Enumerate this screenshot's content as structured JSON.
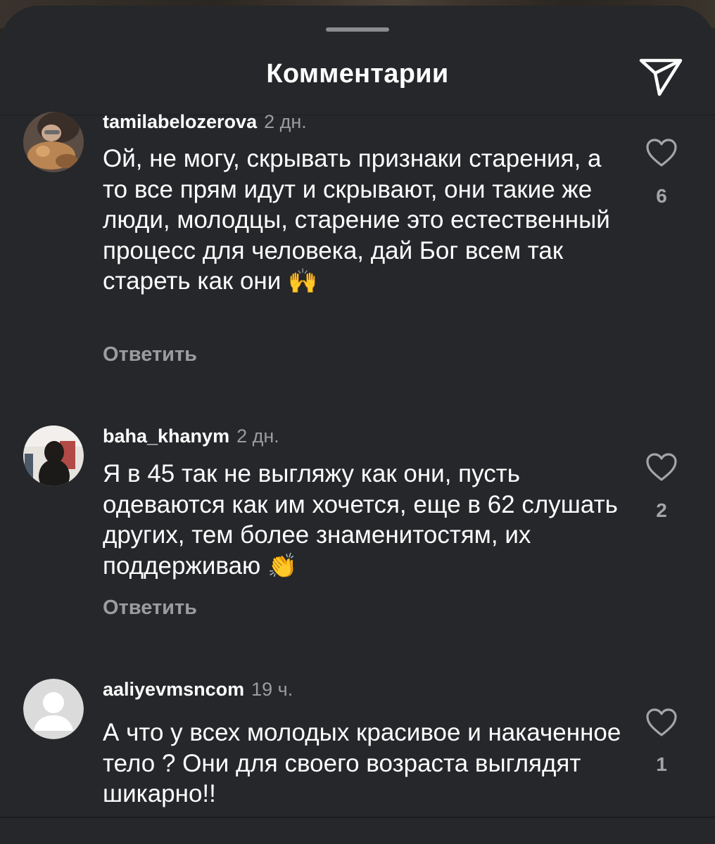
{
  "header": {
    "title": "Комментарии",
    "share_icon": "send-icon"
  },
  "comments": [
    {
      "username": "tamilabelozerova",
      "time": "2 дн.",
      "text": "Ой, не могу, скрывать признаки старения, а то все прям идут и скрывают, они такие же люди, молодцы, старение это естественный процесс для человека, дай Бог всем так стареть как они",
      "emoji": "🙌",
      "reply_label": "Ответить",
      "likes": "6",
      "avatar": "photo-avatar"
    },
    {
      "username": "baha_khanym",
      "time": "2 дн.",
      "text": "Я в 45 так не выгляжу как они, пусть одеваются как им хочется, еще в 62 слушать других, тем более знаменитостям, их поддерживаю",
      "emoji": "👏",
      "reply_label": "Ответить",
      "likes": "2",
      "avatar": "photo-avatar"
    },
    {
      "username": "aaliyevmsncom",
      "time": "19 ч.",
      "text": "А что у всех молодых красивое и накаченное тело ? Они для своего возраста выглядят шикарно!!",
      "likes": "1",
      "avatar": "default-avatar"
    }
  ],
  "colors": {
    "sheet_bg": "#25272a",
    "text_primary": "#ffffff",
    "text_secondary": "#9a9ca0"
  }
}
